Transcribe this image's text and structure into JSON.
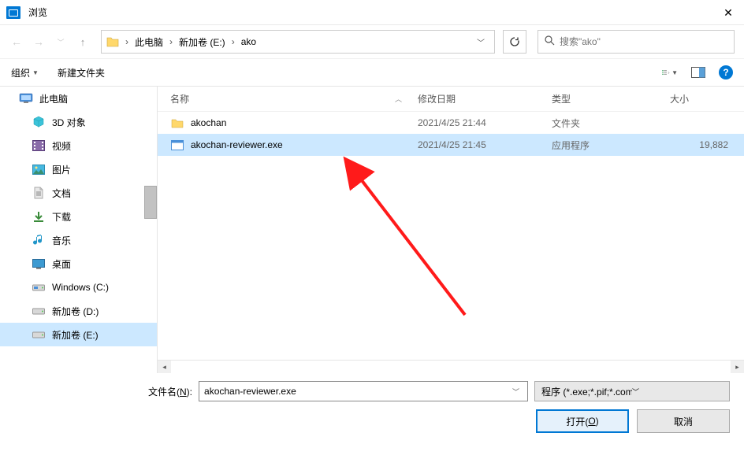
{
  "window": {
    "title": "浏览"
  },
  "breadcrumb": {
    "items": [
      "此电脑",
      "新加卷 (E:)",
      "ako"
    ]
  },
  "search": {
    "placeholder": "搜索\"ako\""
  },
  "toolbar": {
    "organize": "组织",
    "new_folder": "新建文件夹"
  },
  "sidebar": {
    "pc": "此电脑",
    "items": [
      {
        "label": "3D 对象"
      },
      {
        "label": "视频"
      },
      {
        "label": "图片"
      },
      {
        "label": "文档"
      },
      {
        "label": "下载"
      },
      {
        "label": "音乐"
      },
      {
        "label": "桌面"
      },
      {
        "label": "Windows (C:)"
      },
      {
        "label": "新加卷 (D:)"
      },
      {
        "label": "新加卷 (E:)"
      }
    ]
  },
  "columns": {
    "name": "名称",
    "date": "修改日期",
    "type": "类型",
    "size": "大小"
  },
  "files": [
    {
      "name": "akochan",
      "date": "2021/4/25 21:44",
      "type": "文件夹",
      "size": ""
    },
    {
      "name": "akochan-reviewer.exe",
      "date": "2021/4/25 21:45",
      "type": "应用程序",
      "size": "19,882"
    }
  ],
  "footer": {
    "filename_label_pre": "文件名(",
    "filename_label_u": "N",
    "filename_label_post": "):",
    "filename_value": "akochan-reviewer.exe",
    "filter": "程序 (*.exe;*.pif;*.com;*.bat;*",
    "open_pre": "打开(",
    "open_u": "O",
    "open_post": ")",
    "cancel": "取消"
  }
}
